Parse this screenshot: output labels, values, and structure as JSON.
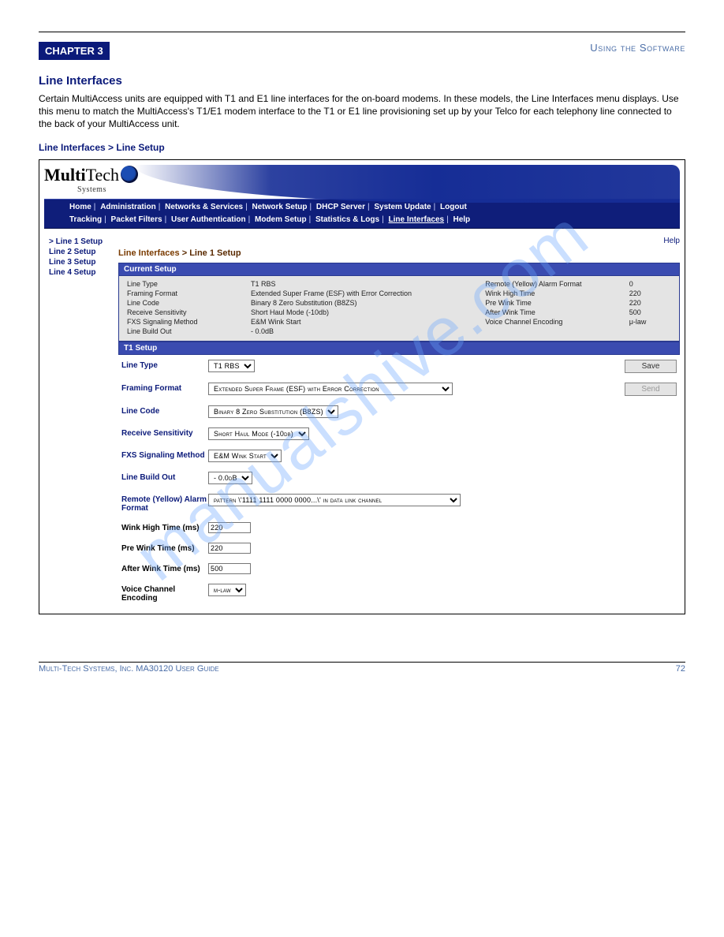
{
  "chapter": {
    "badge": "CHAPTER 3",
    "title": "Using the Software"
  },
  "section": {
    "heading": "Line Interfaces",
    "intro": "Certain MultiAccess units are equipped with T1 and E1 line interfaces for the on-board modems. In these models, the Line Interfaces menu displays. Use this menu to match the MultiAccess's T1/E1 modem interface to the T1 or E1 line provisioning set up by your Telco for each telephony line connected to the back of your MultiAccess unit.",
    "sub": "Line Interfaces > Line Setup"
  },
  "logo": {
    "multi": "Multi",
    "tech": "Tech",
    "systems": "Systems"
  },
  "nav": {
    "row1": [
      "Home",
      "Administration",
      "Networks & Services",
      "Network Setup",
      "DHCP Server",
      "System Update",
      "Logout"
    ],
    "row2": [
      "Tracking",
      "Packet Filters",
      "User Authentication",
      "Modem Setup",
      "Statistics & Logs",
      "Line Interfaces",
      "Help"
    ]
  },
  "sidenav": [
    "Line 1 Setup",
    "Line 2 Setup",
    "Line 3 Setup",
    "Line 4 Setup"
  ],
  "help": "Help",
  "breadcrumb": {
    "root": "Line Interfaces",
    "leaf": "Line 1 Setup"
  },
  "panels": {
    "current": {
      "title": "Current Setup",
      "rows": [
        {
          "l": "Line Type",
          "v": "T1 RBS",
          "l2": "Remote (Yellow) Alarm Format",
          "v2": "0"
        },
        {
          "l": "Framing Format",
          "v": "Extended Super Frame (ESF) with Error Correction",
          "l2": "Wink High Time",
          "v2": "220"
        },
        {
          "l": "Line Code",
          "v": "Binary 8 Zero Substitution (B8ZS)",
          "l2": "Pre Wink Time",
          "v2": "220"
        },
        {
          "l": "Receive Sensitivity",
          "v": "Short Haul Mode (-10db)",
          "l2": "After Wink Time",
          "v2": "500"
        },
        {
          "l": "FXS Signaling Method",
          "v": "E&M Wink Start",
          "l2": "Voice Channel Encoding",
          "v2": "μ-law"
        },
        {
          "l": "Line Build Out",
          "v": "- 0.0dB",
          "l2": "",
          "v2": ""
        }
      ]
    },
    "setup": {
      "title": "T1 Setup",
      "buttons": {
        "save": "Save",
        "send": "Send"
      },
      "fields": {
        "line_type": {
          "label": "Line Type",
          "value": "T1 RBS"
        },
        "framing": {
          "label": "Framing Format",
          "value": "Extended Super Frame (ESF) with Error Correction"
        },
        "line_code": {
          "label": "Line Code",
          "value": "Binary 8 Zero Substitution (B8ZS)"
        },
        "recv_sens": {
          "label": "Receive Sensitivity",
          "value": "Short Haul Mode (-10db)"
        },
        "fxs": {
          "label": "FXS Signaling Method",
          "value": "E&M Wink Start"
        },
        "lbo": {
          "label": "Line Build Out",
          "value": "- 0.0dB"
        },
        "remote_alarm": {
          "label": "Remote (Yellow) Alarm Format",
          "value": "pattern \\'1111 1111 0000 0000...\\' in data link channel"
        },
        "wink_high": {
          "label": "Wink High Time (ms)",
          "value": "220"
        },
        "pre_wink": {
          "label": "Pre Wink Time (ms)",
          "value": "220"
        },
        "after_wink": {
          "label": "After Wink Time (ms)",
          "value": "500"
        },
        "voice_enc": {
          "label": "Voice Channel Encoding",
          "value": "μ-law"
        }
      }
    }
  },
  "footer": {
    "left": "Multi-Tech Systems, Inc. MA30120 User Guide",
    "right": "72"
  },
  "watermark": "manualshive.com"
}
